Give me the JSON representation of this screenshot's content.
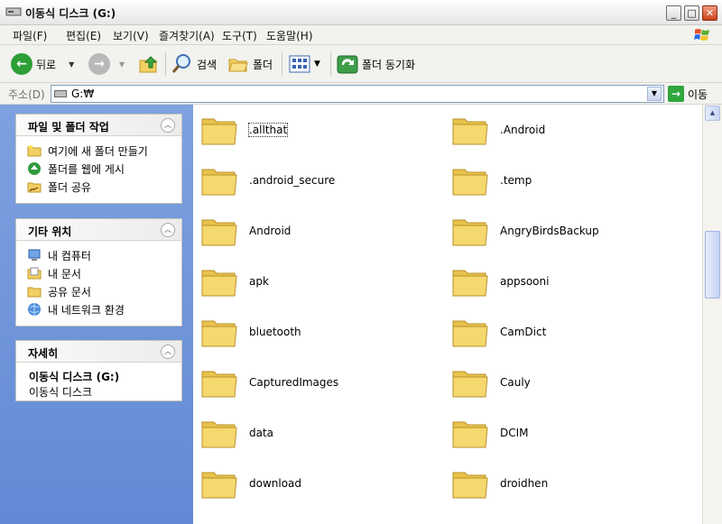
{
  "window": {
    "title": "이동식 디스크 (G:)"
  },
  "menubar": {
    "items": [
      "파일(F)",
      "편집(E)",
      "보기(V)",
      "즐겨찾기(A)",
      "도구(T)",
      "도움말(H)"
    ]
  },
  "toolbar": {
    "back_label": "뒤로",
    "search_label": "검색",
    "folders_label": "폴더",
    "sync_label": "폴더 동기화"
  },
  "address": {
    "label": "주소(D)",
    "value": "G:₩",
    "go_label": "이동"
  },
  "tasks": {
    "file_folder": {
      "title": "파일 및 폴더 작업",
      "items": [
        "여기에 새 폴더 만들기",
        "폴더를 웹에 게시",
        "폴더 공유"
      ]
    },
    "other_places": {
      "title": "기타 위치",
      "items": [
        "내 컴퓨터",
        "내 문서",
        "공유 문서",
        "내 네트워크 환경"
      ]
    },
    "details": {
      "title": "자세히",
      "name": "이동식 디스크 (G:)",
      "type": "이동식 디스크"
    }
  },
  "files": [
    ".allthat",
    ".Android",
    ".android_secure",
    ".temp",
    "Android",
    "AngryBirdsBackup",
    "apk",
    "appsooni",
    "bluetooth",
    "CamDict",
    "CapturedImages",
    "Cauly",
    "data",
    "DCIM",
    "download",
    "droidhen"
  ],
  "colors": {
    "folder": "#f2d064",
    "sidebar": "#7ea1e0"
  }
}
